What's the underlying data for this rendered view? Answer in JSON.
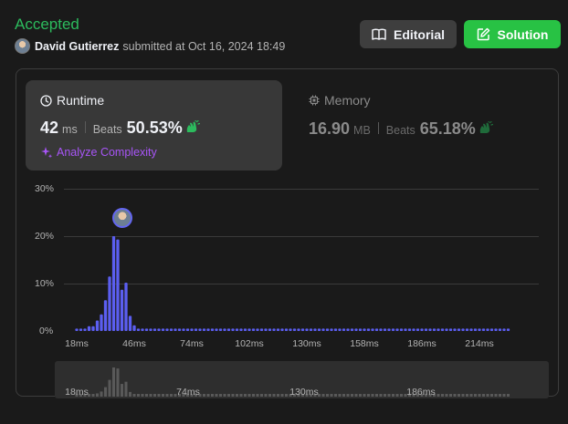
{
  "submission": {
    "status": "Accepted",
    "user": "David Gutierrez",
    "submitted_text": "submitted at Oct 16, 2024 18:49"
  },
  "toolbar": {
    "editorial_label": "Editorial",
    "solution_label": "Solution",
    "editorial_icon": "book-icon",
    "solution_icon": "edit-icon"
  },
  "runtime": {
    "title": "Runtime",
    "value": "42",
    "unit": "ms",
    "beats_label": "Beats",
    "beats_pct": "50.53%",
    "analyze_label": "Analyze Complexity"
  },
  "memory": {
    "title": "Memory",
    "value": "16.90",
    "unit": "MB",
    "beats_label": "Beats",
    "beats_pct": "65.18%"
  },
  "colors": {
    "accepted": "#2cbb5d",
    "solution_btn": "#28c244",
    "bar": "#5b5ef0",
    "overview_bar": "#595959",
    "analyze": "#a855f7"
  },
  "chart_data": {
    "type": "bar",
    "x_unit": "ms",
    "x_start": 18,
    "x_step": 1,
    "y_ticks": [
      "0%",
      "10%",
      "20%",
      "30%"
    ],
    "x_ticks": [
      "18ms",
      "46ms",
      "74ms",
      "102ms",
      "130ms",
      "158ms",
      "186ms",
      "214ms"
    ],
    "ylim": [
      0,
      30
    ],
    "grid": true,
    "highlight": {
      "x": 42
    },
    "values": [
      0.5,
      0.5,
      0.5,
      1,
      1,
      2.2,
      3.5,
      6.5,
      11.5,
      20,
      19.3,
      8.7,
      10.2,
      3.2,
      1.2,
      0.5,
      0.5,
      0.5,
      0.5,
      0.5,
      0.5,
      0.5,
      0.5,
      0.5,
      0.5,
      0.5,
      0.5,
      0.5,
      0.5,
      0.5,
      0.5,
      0.5,
      0.5,
      0.5,
      0.5,
      0.5,
      0.5,
      0.5,
      0.5,
      0.5,
      0.5,
      0.5,
      0.5,
      0.5,
      0.5,
      0.5,
      0.5,
      0.5,
      0.5,
      0.5,
      0.5,
      0.5,
      0.5,
      0.5,
      0.5,
      0.5,
      0.5,
      0.5,
      0.5,
      0.5,
      0.5,
      0.5,
      0.5,
      0.5,
      0.5,
      0.5,
      0.5,
      0.5,
      0.5,
      0.5,
      0.5,
      0.5,
      0.5,
      0.5,
      0.5,
      0.5,
      0.5,
      0.5,
      0.5,
      0.5,
      0.5,
      0.5,
      0.5,
      0.5,
      0.5,
      0.5,
      0.5,
      0.5,
      0.5,
      0.5,
      0.5,
      0.5,
      0.5,
      0.5,
      0.5,
      0.5,
      0.5,
      0.5,
      0.5,
      0.5,
      0.5,
      0.5,
      0.5,
      0.5,
      0.5,
      0.5
    ]
  },
  "overview": {
    "x_ticks": [
      "18ms",
      "74ms",
      "130ms",
      "186ms"
    ]
  }
}
